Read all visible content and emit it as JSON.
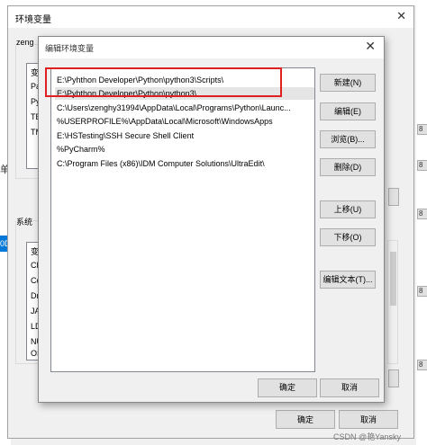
{
  "outer_dialog": {
    "title": "环境变量",
    "close_glyph": "✕",
    "user_section_label": "zeng",
    "user_vars_rows": [
      "变",
      "Pa",
      "Py",
      "TE",
      "TM"
    ],
    "system_section_label": "系统",
    "system_vars_rows": [
      "变",
      "CL",
      "Co",
      "Dr",
      "JA",
      "LD",
      "NU",
      "OS"
    ],
    "ok": "确定",
    "cancel": "取消"
  },
  "inner_dialog": {
    "title": "编辑环境变量",
    "close_glyph": "✕",
    "paths": [
      "E:\\Pyhthon Developer\\Python\\python3\\Scripts\\",
      "E:\\Pyhthon Developer\\Python\\python3\\",
      "C:\\Users\\zenghy31994\\AppData\\Local\\Programs\\Python\\Launc...",
      "%USERPROFILE%\\AppData\\Local\\Microsoft\\WindowsApps",
      "E:\\HSTesting\\SSH Secure Shell Client",
      "%PyCharm%",
      "C:\\Program Files (x86)\\IDM Computer Solutions\\UltraEdit\\"
    ],
    "selected_index": 1,
    "buttons": {
      "new": "新建(N)",
      "edit": "编辑(E)",
      "browse": "浏览(B)...",
      "delete": "删除(D)",
      "move_up": "上移(U)",
      "move_down": "下移(O)",
      "edit_text": "编辑文本(T)..."
    },
    "ok": "确定",
    "cancel": "取消"
  },
  "background": {
    "left_chars": [
      "单",
      "0D"
    ],
    "right_tabs": [
      "8",
      "8",
      "8",
      "8",
      "8"
    ]
  },
  "watermark": "CSDN @艳Yansky",
  "colors": {
    "highlight_border": "#e02020",
    "selected_row": "#e5e5e5",
    "accent_blue": "#0078d7"
  }
}
